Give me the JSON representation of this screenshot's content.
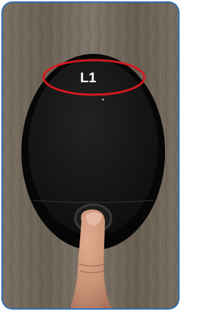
{
  "photo": {
    "subject": "fingerprint-lock-device",
    "annotation": {
      "text": "L1",
      "ring_color": "#d71921"
    },
    "colors": {
      "frame": "#2f6fb1",
      "wood_base": "#6f6558",
      "device_body": "#141414",
      "device_bezel": "#050505",
      "finger": "#c99276"
    }
  }
}
